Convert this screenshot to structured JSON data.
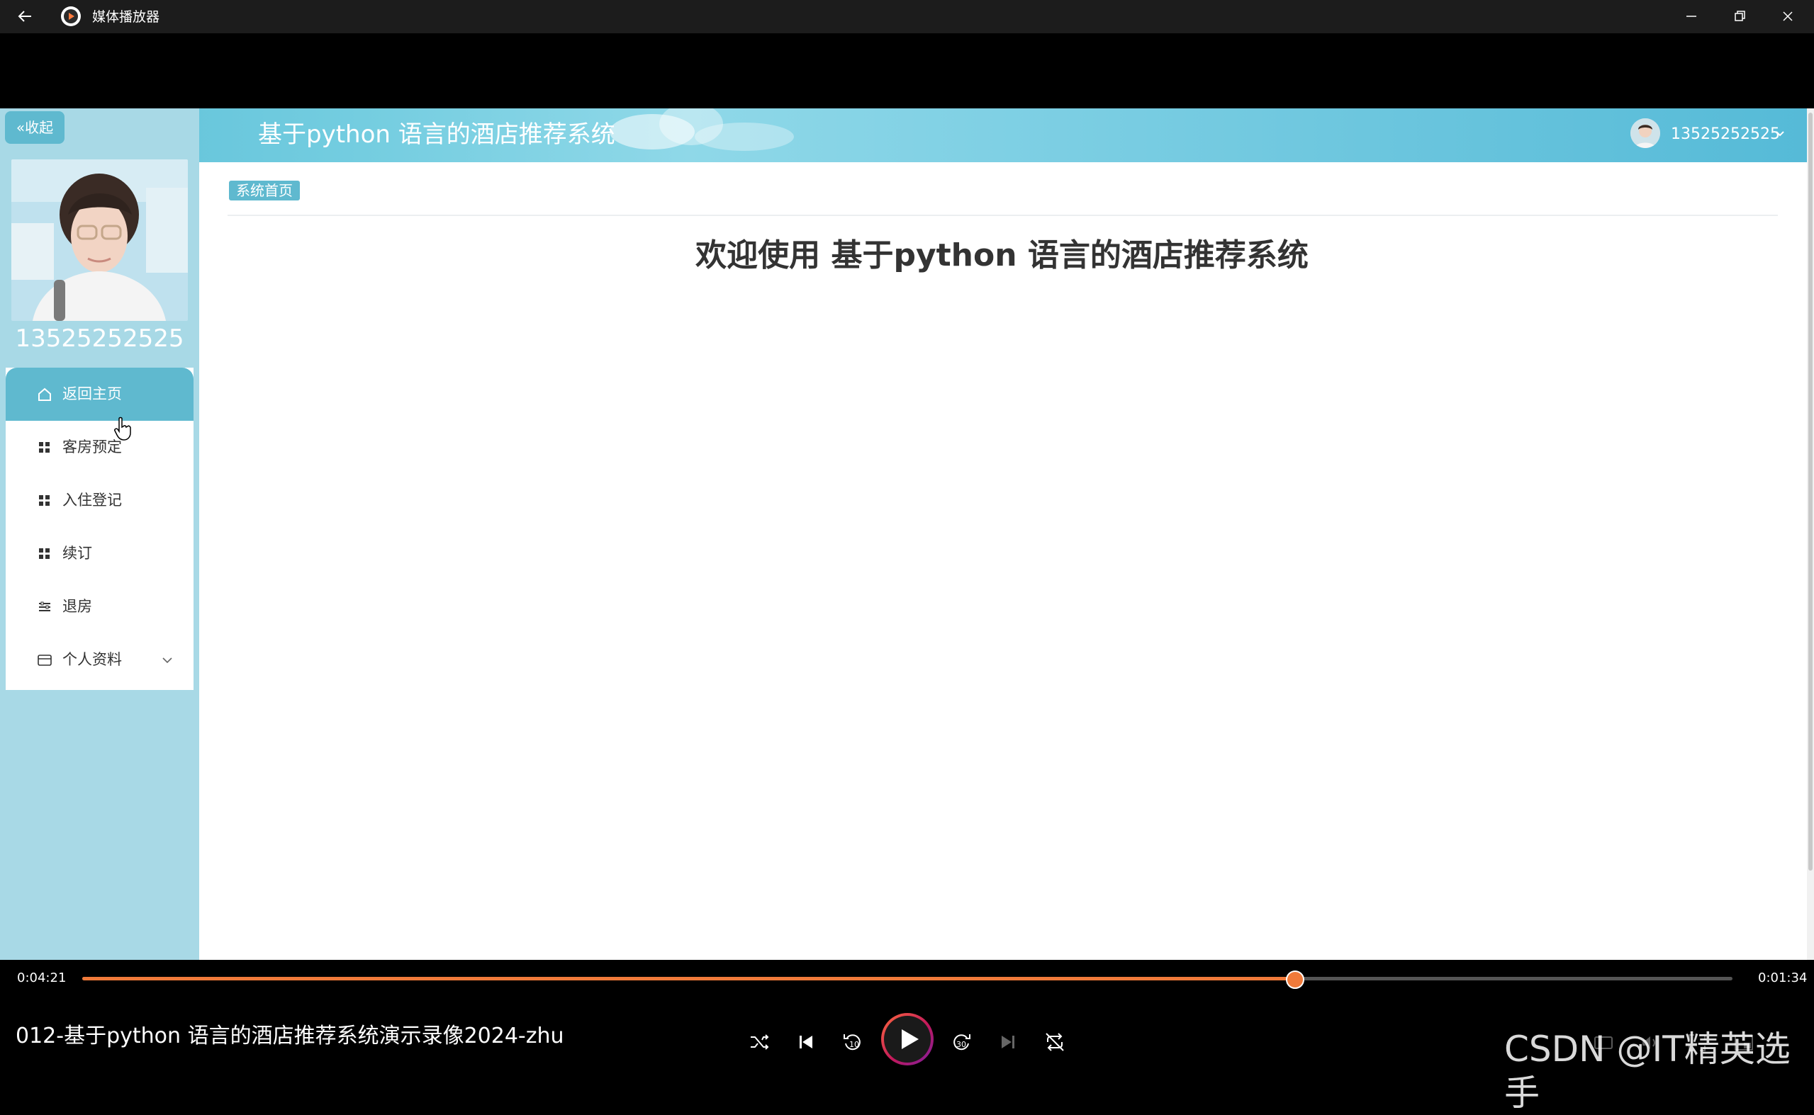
{
  "window": {
    "title": "媒体播放器",
    "icons": [
      "back-arrow-icon",
      "app-play-icon",
      "minimize-icon",
      "restore-icon",
      "close-icon"
    ]
  },
  "app": {
    "header_title": "基于python 语言的酒店推荐系统",
    "user_name": "13525252525",
    "sidebar": {
      "collapse_label": "收起",
      "profile_name": "13525252525",
      "menu": [
        {
          "label": "返回主页",
          "icon": "home-icon",
          "active": true
        },
        {
          "label": "客房预定",
          "icon": "grid-icon"
        },
        {
          "label": "入住登记",
          "icon": "grid-icon"
        },
        {
          "label": "续订",
          "icon": "grid-icon"
        },
        {
          "label": "退房",
          "icon": "sliders-icon"
        },
        {
          "label": "个人资料",
          "icon": "id-card-icon",
          "has_submenu": true
        }
      ]
    },
    "breadcrumb": "系统首页",
    "welcome": "欢迎使用 基于python 语言的酒店推荐系统",
    "colors": {
      "accent": "#5fb9cf",
      "sidebar_bg": "#a8d9e6",
      "header": "#5cc0d8"
    }
  },
  "player": {
    "time_elapsed": "0:04:21",
    "time_remaining": "0:01:34",
    "progress": 0.735,
    "media_title": "012-基于python 语言的酒店推荐系统演示录像2024-zhu",
    "watermark": "CSDN @IT精英选手",
    "accent": "#f07a3a"
  }
}
